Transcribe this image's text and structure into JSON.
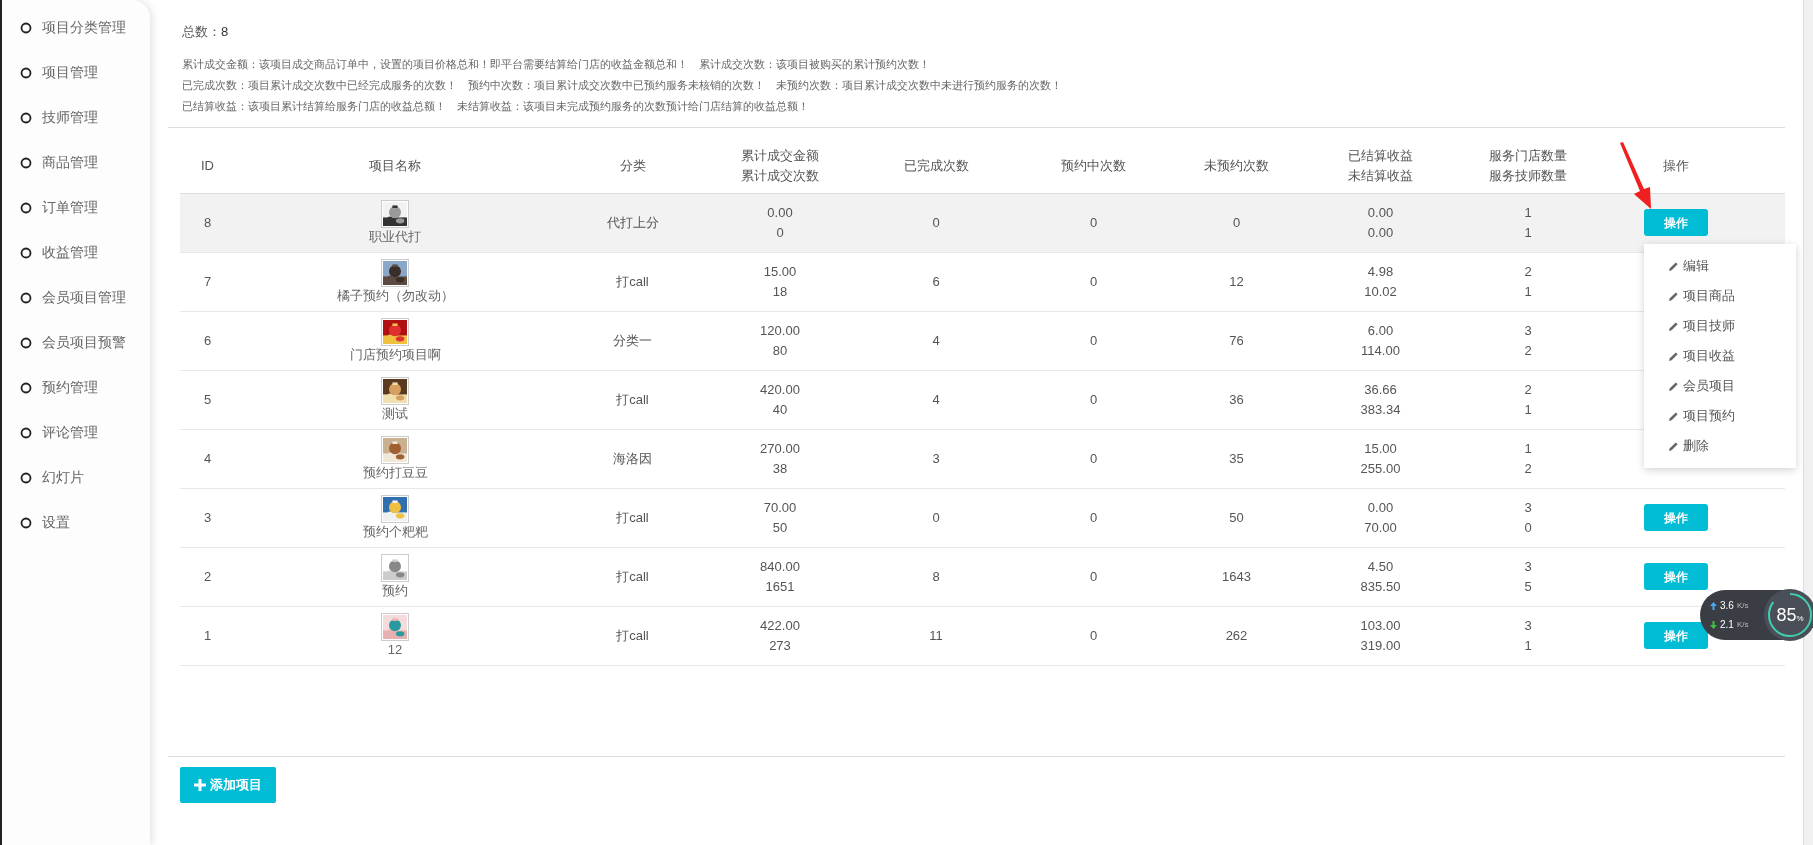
{
  "sidebar": {
    "items": [
      {
        "label": "项目分类管理"
      },
      {
        "label": "项目管理"
      },
      {
        "label": "技师管理"
      },
      {
        "label": "商品管理"
      },
      {
        "label": "订单管理"
      },
      {
        "label": "收益管理"
      },
      {
        "label": "会员项目管理"
      },
      {
        "label": "会员项目预警"
      },
      {
        "label": "预约管理"
      },
      {
        "label": "评论管理"
      },
      {
        "label": "幻灯片"
      },
      {
        "label": "设置"
      }
    ]
  },
  "total": {
    "label": "总数：",
    "value": "8"
  },
  "notes": [
    "累计成交金额：该项目成交商品订单中，设置的项目价格总和！即平台需要结算给门店的收益金额总和！　累计成交次数：该项目被购买的累计预约次数！",
    "已完成次数：项目累计成交次数中已经完成服务的次数！　预约中次数：项目累计成交次数中已预约服务未核销的次数！　未预约次数：项目累计成交次数中未进行预约服务的次数！",
    "已结算收益：该项目累计结算给服务门店的收益总额！　未结算收益：该项目未完成预约服务的次数预计给门店结算的收益总额！"
  ],
  "table": {
    "columns": [
      [
        "ID"
      ],
      [
        "项目名称"
      ],
      [
        "分类"
      ],
      [
        "累计成交金额",
        "累计成交次数"
      ],
      [
        "已完成次数"
      ],
      [
        "预约中次数"
      ],
      [
        "未预约次数"
      ],
      [
        "已结算收益",
        "未结算收益"
      ],
      [
        "服务门店数量",
        "服务技师数量"
      ],
      [
        "操作"
      ]
    ],
    "rows": [
      {
        "id": "8",
        "name": "职业代打",
        "category": "代打上分",
        "amount": "0.00",
        "count": "0",
        "done": "0",
        "booked": "0",
        "unbooked": "0",
        "settled": "0.00",
        "unsettled": "0.00",
        "stores": "1",
        "techs": "1",
        "action": "操作",
        "selected": true
      },
      {
        "id": "7",
        "name": "橘子预约（勿改动）",
        "category": "打call",
        "amount": "15.00",
        "count": "18",
        "done": "6",
        "booked": "0",
        "unbooked": "12",
        "settled": "4.98",
        "unsettled": "10.02",
        "stores": "2",
        "techs": "1",
        "selected": false
      },
      {
        "id": "6",
        "name": "门店预约项目啊",
        "category": "分类一",
        "amount": "120.00",
        "count": "80",
        "done": "4",
        "booked": "0",
        "unbooked": "76",
        "settled": "6.00",
        "unsettled": "114.00",
        "stores": "3",
        "techs": "2",
        "selected": false
      },
      {
        "id": "5",
        "name": "测试",
        "category": "打call",
        "amount": "420.00",
        "count": "40",
        "done": "4",
        "booked": "0",
        "unbooked": "36",
        "settled": "36.66",
        "unsettled": "383.34",
        "stores": "2",
        "techs": "1",
        "selected": false
      },
      {
        "id": "4",
        "name": "预约打豆豆",
        "category": "海洛因",
        "amount": "270.00",
        "count": "38",
        "done": "3",
        "booked": "0",
        "unbooked": "35",
        "settled": "15.00",
        "unsettled": "255.00",
        "stores": "1",
        "techs": "2",
        "selected": false
      },
      {
        "id": "3",
        "name": "预约个粑粑",
        "category": "打call",
        "amount": "70.00",
        "count": "50",
        "done": "0",
        "booked": "0",
        "unbooked": "50",
        "settled": "0.00",
        "unsettled": "70.00",
        "stores": "3",
        "techs": "0",
        "action": "操作",
        "selected": false
      },
      {
        "id": "2",
        "name": "预约",
        "category": "打call",
        "amount": "840.00",
        "count": "1651",
        "done": "8",
        "booked": "0",
        "unbooked": "1643",
        "settled": "4.50",
        "unsettled": "835.50",
        "stores": "3",
        "techs": "5",
        "action": "操作",
        "selected": false
      },
      {
        "id": "1",
        "name": "12",
        "category": "打call",
        "amount": "422.00",
        "count": "273",
        "done": "11",
        "booked": "0",
        "unbooked": "262",
        "settled": "103.00",
        "unsettled": "319.00",
        "stores": "3",
        "techs": "1",
        "action": "操作",
        "selected": false
      }
    ]
  },
  "dropdown": {
    "items": [
      "编辑",
      "项目商品",
      "项目技师",
      "项目收益",
      "会员项目",
      "项目预约",
      "删除"
    ]
  },
  "add_button": {
    "label": "添加项目"
  },
  "net_monitor": {
    "up": "3.6",
    "up_unit": "K/s",
    "down": "2.1",
    "down_unit": "K/s",
    "percent": "85",
    "percent_unit": "%"
  }
}
